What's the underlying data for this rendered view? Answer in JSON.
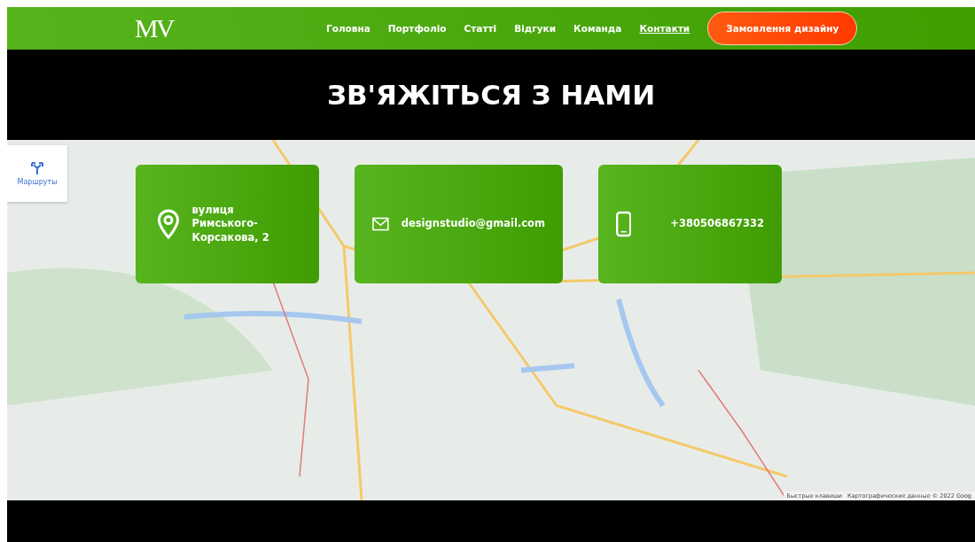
{
  "header": {
    "logo": "MV",
    "nav": [
      {
        "label": "Головна",
        "selected": false
      },
      {
        "label": "Портфоліо",
        "selected": false
      },
      {
        "label": "Статті",
        "selected": false
      },
      {
        "label": "Відгуки",
        "selected": false
      },
      {
        "label": "Команда",
        "selected": false
      },
      {
        "label": "Контакти",
        "selected": true
      }
    ],
    "cta": "Замовлення дизайну"
  },
  "hero": {
    "title": "ЗВ'ЯЖІТЬСЯ З НАМИ"
  },
  "map": {
    "directions_label": "Маршруты",
    "attribution": [
      "Быстрые клавиши",
      "Картографические данные © 2022 Goog"
    ]
  },
  "contacts": [
    {
      "kind": "address",
      "text": "вулиця Римського-Корсакова, 2"
    },
    {
      "kind": "email",
      "text": "designstudio@gmail.com"
    },
    {
      "kind": "phone",
      "text": "+380506867332"
    }
  ]
}
